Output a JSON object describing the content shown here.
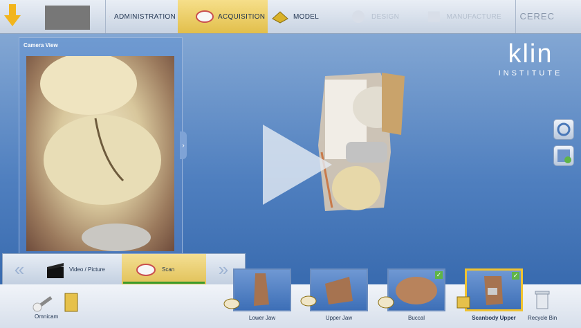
{
  "workflow": {
    "steps": [
      {
        "label": "ADMINISTRATION",
        "state": "done"
      },
      {
        "label": "ACQUISITION",
        "state": "active"
      },
      {
        "label": "MODEL",
        "state": "enabled"
      },
      {
        "label": "DESIGN",
        "state": "disabled"
      },
      {
        "label": "MANUFACTURE",
        "state": "disabled"
      }
    ],
    "product_name": "CEREC"
  },
  "camera_panel": {
    "title": "Camera View"
  },
  "logo": {
    "main": "klin",
    "sub": "INSTITUTE"
  },
  "acquisition_nav": {
    "items": [
      {
        "label": "Video / Picture"
      },
      {
        "label": "Scan",
        "active": true
      }
    ]
  },
  "bottom": {
    "omnicam_label": "Omnicam",
    "catalog": [
      {
        "label": "Lower Jaw",
        "checked": false
      },
      {
        "label": "Upper Jaw",
        "checked": false
      },
      {
        "label": "Buccal",
        "checked": true
      },
      {
        "label": "Scanbody Upper",
        "checked": true,
        "selected": true
      }
    ],
    "recycle_label": "Recycle Bin"
  },
  "icons": {
    "back": "back-arrow-icon",
    "check": "✓",
    "play": "play-icon",
    "nav_left": "«",
    "nav_right": "»",
    "handle": "›"
  }
}
